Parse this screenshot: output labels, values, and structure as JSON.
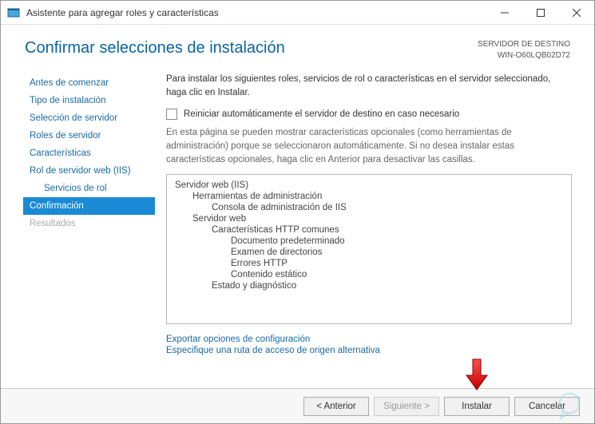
{
  "window": {
    "title": "Asistente para agregar roles y características"
  },
  "header": {
    "page_title": "Confirmar selecciones de instalación",
    "dest_label": "SERVIDOR DE DESTINO",
    "dest_value": "WIN-O60LQB02D72"
  },
  "sidebar": {
    "items": [
      {
        "label": "Antes de comenzar"
      },
      {
        "label": "Tipo de instalación"
      },
      {
        "label": "Selección de servidor"
      },
      {
        "label": "Roles de servidor"
      },
      {
        "label": "Características"
      },
      {
        "label": "Rol de servidor web (IIS)"
      },
      {
        "label": "Servicios de rol"
      },
      {
        "label": "Confirmación"
      },
      {
        "label": "Resultados"
      }
    ]
  },
  "content": {
    "intro": "Para instalar los siguientes roles, servicios de rol o características en el servidor seleccionado, haga clic en Instalar.",
    "auto_restart_label": "Reiniciar automáticamente el servidor de destino en caso necesario",
    "note": "En esta página se pueden mostrar características opcionales (como herramientas de administración) porque se seleccionaron automáticamente. Si no desea instalar estas características opcionales, haga clic en Anterior para desactivar las casillas.",
    "features": [
      "Servidor web (IIS)",
      "Herramientas de administración",
      "Consola de administración de IIS",
      "Servidor web",
      "Características HTTP comunes",
      "Documento predeterminado",
      "Examen de directorios",
      "Errores HTTP",
      "Contenido estático",
      "Estado y diagnóstico"
    ],
    "link_export": "Exportar opciones de configuración",
    "link_altpath": "Especifique una ruta de acceso de origen alternativa"
  },
  "footer": {
    "prev": "< Anterior",
    "next": "Siguiente >",
    "install": "Instalar",
    "cancel": "Cancelar"
  }
}
